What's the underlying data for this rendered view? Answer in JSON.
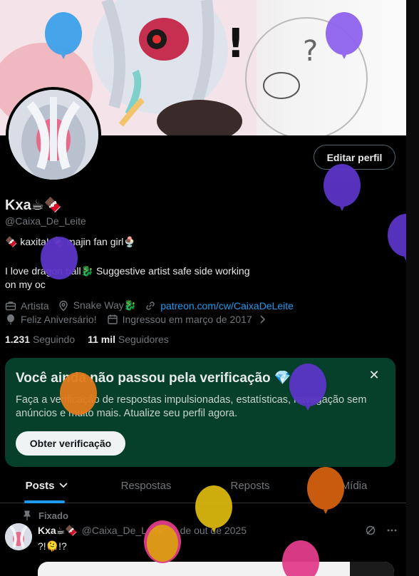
{
  "profile": {
    "display_name": "Kxa☕🍫",
    "handle": "@Caixa_De_Leite",
    "bio_line1": "🍫 kaxita! 🍫 majin fan girl🍨",
    "bio_line2": "I love dragon ball🐉 Suggestive artist safe side working on my oc",
    "edit_button": "Editar perfil",
    "category": "Artista",
    "location": "Snake Way🐉",
    "link": "patreon.com/cw/CaixaDeLeite",
    "birthday": "Feliz Aniversário!",
    "joined": "Ingressou em março de 2017",
    "following_count": "1.231",
    "following_label": "Seguindo",
    "followers_count": "11 mil",
    "followers_label": "Seguidores"
  },
  "verification": {
    "title": "Você ainda não passou pela verificação 💎",
    "text": "Faça a verificação de respostas impulsionadas, estatísticas, navegação sem anúncios e muito mais. Atualize seu perfil agora.",
    "button": "Obter verificação",
    "close": "✕",
    "bg_color": "#06402b"
  },
  "tabs": [
    "Posts",
    "Respostas",
    "Reposts",
    "Mídia"
  ],
  "pinned_tweet": {
    "pinned_label": "Fixado",
    "author": "Kxa☕🍫",
    "handle_date": "@Caixa_De_Leite · 5 de out de 2025",
    "text": "?!🫠!?"
  },
  "colors": {
    "accent": "#1d9bf0",
    "muted": "#71767b",
    "text": "#e7e9ea"
  },
  "icons": {
    "category": "briefcase-icon",
    "location": "location-pin-icon",
    "link": "link-icon",
    "birthday": "balloon-icon",
    "joined": "calendar-icon",
    "joined_chevron": "chevron-right-icon",
    "tab_dropdown": "chevron-down-icon",
    "pinned": "pin-icon",
    "grok": "grok-icon",
    "more": "more-icon"
  }
}
